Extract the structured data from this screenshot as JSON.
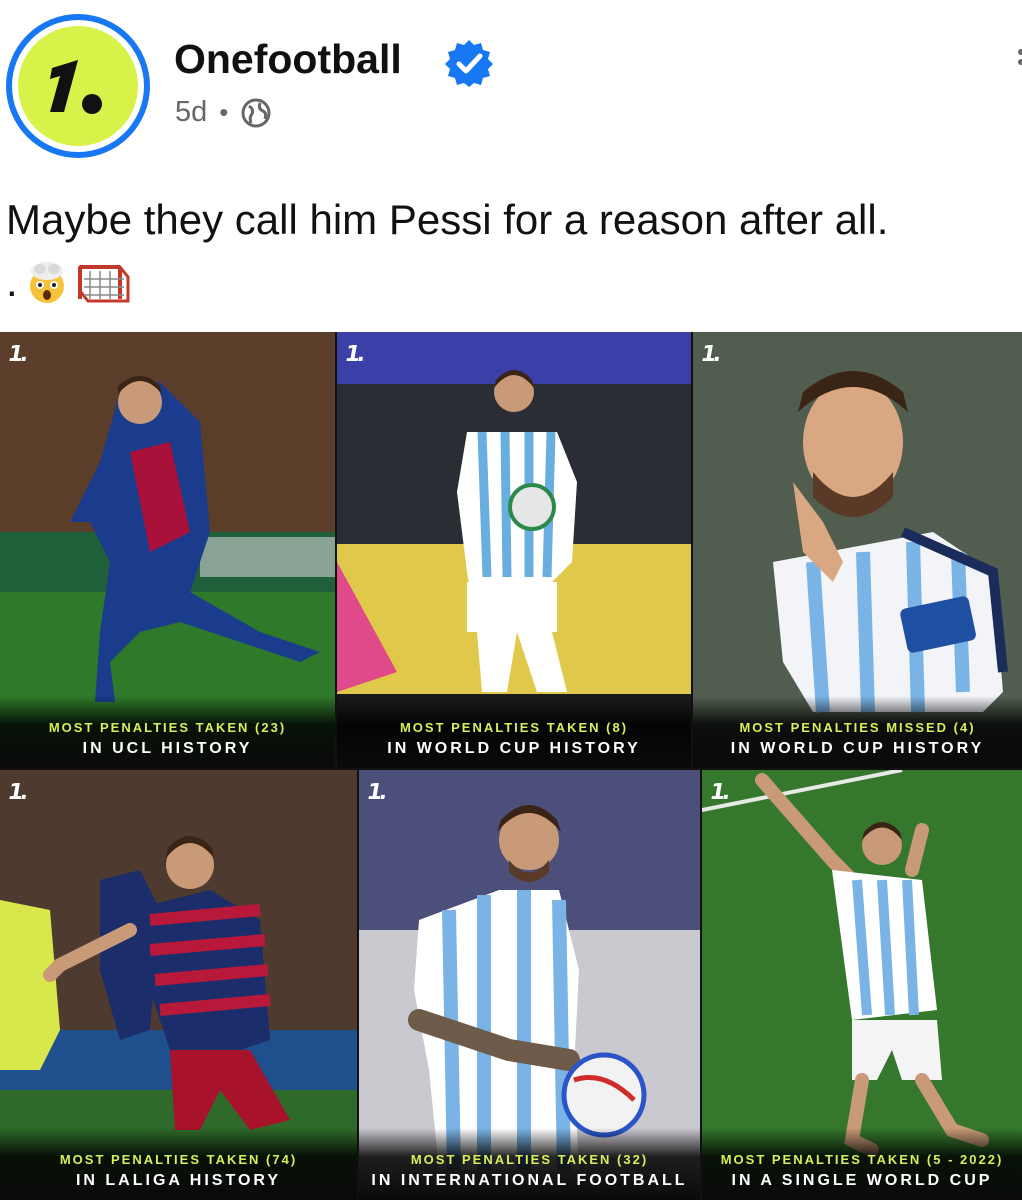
{
  "post": {
    "page_name": "Onefootball",
    "time": "5d",
    "separator": "•",
    "caption": "Maybe they call him Pessi for a reason after all.",
    "caption_line2_prefix": "."
  },
  "icons": {
    "verified": "verified-badge-icon",
    "audience": "globe-icon",
    "emoji_1": "exploding-head-emoji",
    "emoji_2": "goal-net-emoji",
    "brand_logo": "onefootball-logo"
  },
  "colors": {
    "brand_green": "#d8f24a",
    "verified_blue": "#1877f2",
    "caption_accent": "#d6ef5a"
  },
  "tiles": [
    {
      "stat": "MOST PENALTIES TAKEN (23)",
      "context": "IN UCL HISTORY"
    },
    {
      "stat": "MOST PENALTIES TAKEN (8)",
      "context": "IN WORLD CUP HISTORY"
    },
    {
      "stat": "MOST PENALTIES MISSED (4)",
      "context": "IN WORLD CUP HISTORY"
    },
    {
      "stat": "MOST PENALTIES TAKEN (74)",
      "context": "IN LALIGA HISTORY"
    },
    {
      "stat": "MOST PENALTIES TAKEN (32)",
      "context": "IN INTERNATIONAL FOOTBALL"
    },
    {
      "stat": "MOST PENALTIES TAKEN (5 - 2022)",
      "context": "IN A SINGLE WORLD CUP"
    }
  ],
  "tile_logo": "1."
}
